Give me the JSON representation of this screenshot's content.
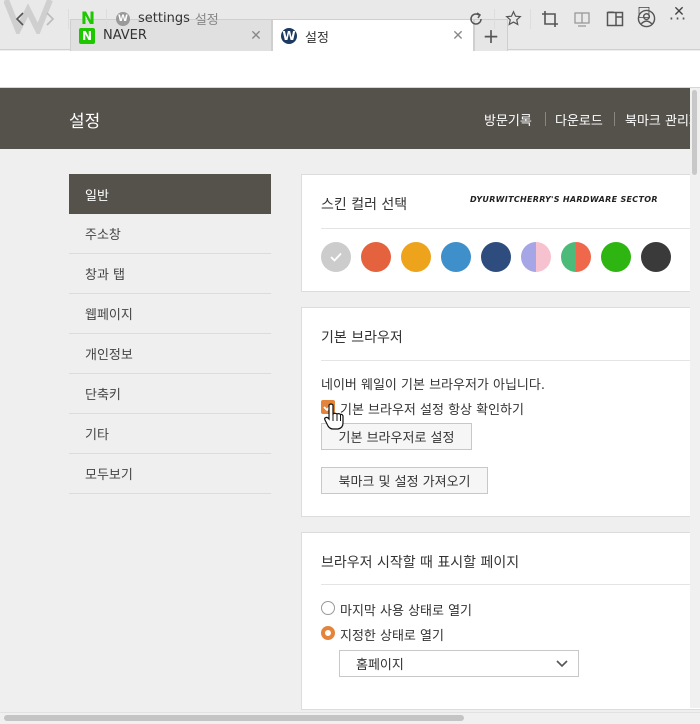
{
  "tabs": [
    {
      "favicon": "N",
      "favicon_color": "#1ec800",
      "title": "NAVER"
    },
    {
      "favicon": "W",
      "favicon_color": "#1d3a63",
      "title": "설정"
    }
  ],
  "window_controls": {
    "minimize": "–",
    "maximize": "□",
    "close": "✕"
  },
  "address": {
    "url_prefix": "settings",
    "url_title": "설정",
    "site_logo": "N"
  },
  "header": {
    "title": "설정",
    "nav": [
      "방문기록",
      "다운로드",
      "북마크 관리자"
    ]
  },
  "sidebar": {
    "items": [
      {
        "label": "일반"
      },
      {
        "label": "주소창"
      },
      {
        "label": "창과 탭"
      },
      {
        "label": "웹페이지"
      },
      {
        "label": "개인정보"
      },
      {
        "label": "단축키"
      },
      {
        "label": "기타"
      },
      {
        "label": "모두보기"
      }
    ]
  },
  "skin": {
    "heading": "스킨 컬러 선택",
    "watermark": "DYURWITCHERRY'S HARDWARE SECTOR",
    "colors": [
      "#cccccc",
      "#e4623e",
      "#eea31d",
      "#3e8fca",
      "#2e4d7e",
      "#a6a6e6|#f7c2cf",
      "#4cba78|#f0684c",
      "#2fb512",
      "#3a3a3a"
    ]
  },
  "default_browser": {
    "heading": "기본 브라우저",
    "status": "네이버 웨일이 기본 브라우저가 아닙니다.",
    "check_label": "기본 브라우저 설정 항상 확인하기",
    "set_button": "기본 브라우저로 설정",
    "import_button": "북마크 및 설정 가져오기"
  },
  "startup": {
    "heading": "브라우저 시작할 때 표시할 페이지",
    "option1": "마지막 사용 상태로 열기",
    "option2": "지정한 상태로 열기",
    "select_value": "홈페이지"
  },
  "colors": {
    "accent": "#e4843a",
    "header_bg": "#55524c"
  }
}
